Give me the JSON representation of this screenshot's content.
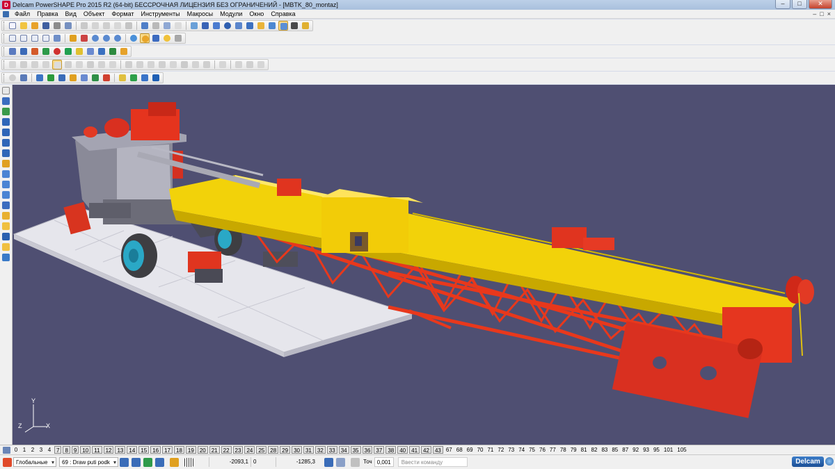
{
  "window": {
    "title": "Delcam PowerSHAPE Pro 2015 R2 (64-bit) БЕССРОЧНАЯ ЛИЦЕНЗИЯ БЕЗ ОГРАНИЧЕНИЙ - [MBTK_80_montaz]",
    "app_icon_glyph": "D"
  },
  "menu": {
    "items": [
      "Файл",
      "Правка",
      "Вид",
      "Объект",
      "Формат",
      "Инструменты",
      "Макросы",
      "Модули",
      "Окно",
      "Справка"
    ],
    "mdi_buttons": [
      "–",
      "□",
      "×"
    ]
  },
  "viewport": {
    "background": "#4f4f72",
    "colors": {
      "boom": "#f2d20a",
      "lattice": "#e8381c",
      "chassis": "#9a9aa6",
      "pad": "#ececf0"
    },
    "axis": {
      "x": "X",
      "y": "Y",
      "z": "Z"
    }
  },
  "layers": {
    "items": [
      "0",
      "1",
      "2",
      "3",
      "4",
      "7",
      "8",
      "9",
      "10",
      "11",
      "12",
      "13",
      "14",
      "15",
      "16",
      "17",
      "18",
      "19",
      "20",
      "21",
      "22",
      "23",
      "24",
      "25",
      "28",
      "29",
      "30",
      "31",
      "32",
      "33",
      "34",
      "35",
      "36",
      "37",
      "38",
      "40",
      "41",
      "42",
      "43",
      "67",
      "68",
      "69",
      "70",
      "71",
      "72",
      "73",
      "74",
      "75",
      "76",
      "77",
      "78",
      "79",
      "81",
      "82",
      "83",
      "85",
      "87",
      "92",
      "93",
      "95",
      "101",
      "105"
    ],
    "boxed": [
      "7",
      "8",
      "9",
      "10",
      "11",
      "12",
      "13",
      "14",
      "15",
      "16",
      "17",
      "18",
      "19",
      "20",
      "21",
      "22",
      "23",
      "24",
      "25",
      "28",
      "29",
      "30",
      "31",
      "32",
      "33",
      "34",
      "35",
      "36",
      "37",
      "38",
      "40",
      "41",
      "42",
      "43"
    ]
  },
  "status": {
    "workplane": "Глобальные",
    "level": "69 : Draw puti podk",
    "x": "-2093,1",
    "y": "0",
    "z": "-1285,3",
    "tolerance_label": "Точ",
    "tolerance": "0,001",
    "command_placeholder": "Ввести команду",
    "brand": "Delcam"
  }
}
